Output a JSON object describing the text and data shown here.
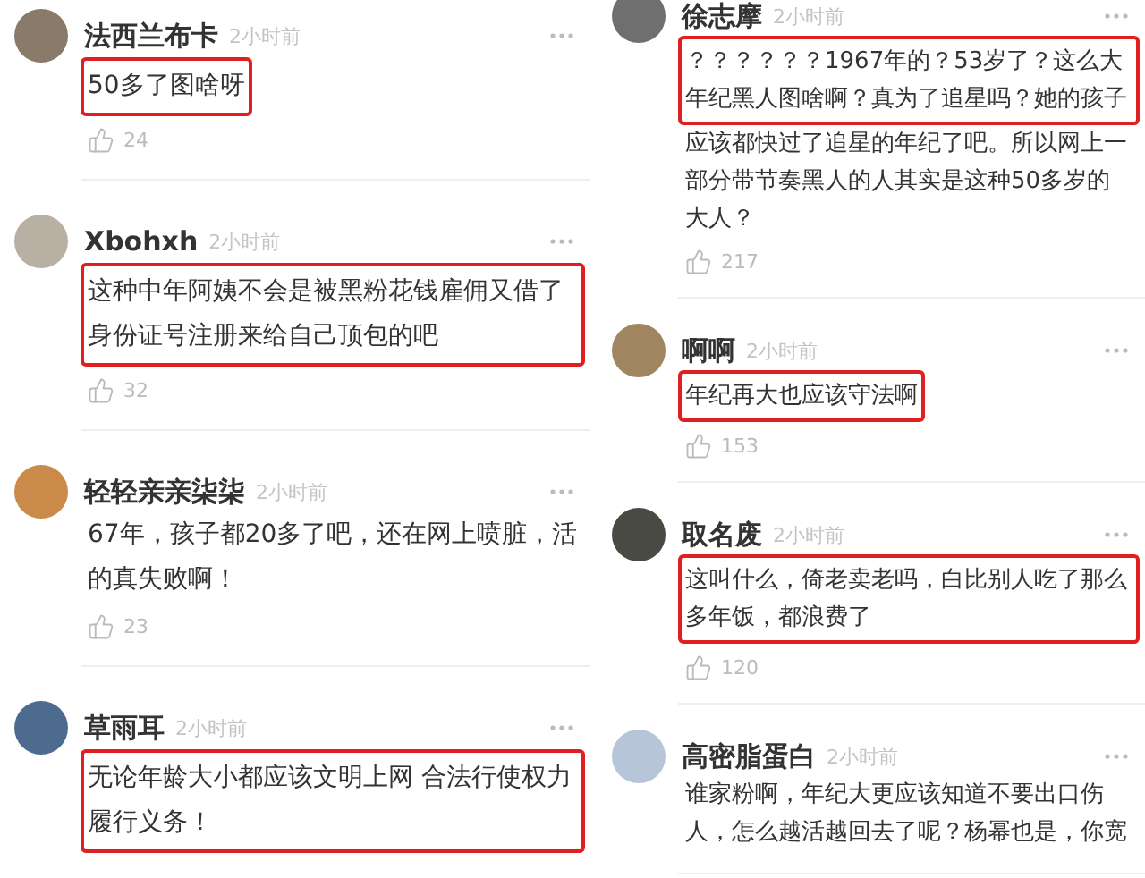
{
  "columns": [
    {
      "comments": [
        {
          "user": "法西兰布卡",
          "time": "2小时前",
          "parts": [
            {
              "text": "50多了图啥呀",
              "highlighted": true
            }
          ],
          "likes": "24"
        },
        {
          "user": "Xbohxh",
          "time": "2小时前",
          "parts": [
            {
              "text": "这种中年阿姨不会是被黑粉花钱雇佣又借了身份证号注册来给自己顶包的吧",
              "highlighted": true
            }
          ],
          "likes": "32"
        },
        {
          "user": "轻轻亲亲柒柒",
          "time": "2小时前",
          "parts": [
            {
              "text": "67年，孩子都20多了吧，还在网上喷脏，活的真失败啊！",
              "highlighted": false
            }
          ],
          "likes": "23"
        },
        {
          "user": "草雨耳",
          "time": "2小时前",
          "parts": [
            {
              "text": "无论年龄大小都应该文明上网 合法行使权力履行义务！",
              "highlighted": true
            }
          ]
        }
      ]
    },
    {
      "comments": [
        {
          "user": "徐志摩",
          "time": "2小时前",
          "parts": [
            {
              "text": "？？？？？？1967年的？53岁了？这么大年纪黑人图啥啊？真为了追星吗？她的孩子",
              "highlighted": true
            },
            {
              "text": "应该都快过了追星的年纪了吧。所以网上一部分带节奏黑人的人其实是这种50多岁的大人？",
              "highlighted": false
            }
          ],
          "likes": "217"
        },
        {
          "user": "啊啊",
          "time": "2小时前",
          "parts": [
            {
              "text": "年纪再大也应该守法啊",
              "highlighted": true
            }
          ],
          "likes": "153"
        },
        {
          "user": "取名废",
          "time": "2小时前",
          "parts": [
            {
              "text": "这叫什么，倚老卖老吗，白比别人吃了那么多年饭，都浪费了",
              "highlighted": true
            }
          ],
          "likes": "120"
        },
        {
          "user": "高密脂蛋白",
          "time": "2小时前",
          "parts": [
            {
              "text": "谁家粉啊，年纪大更应该知道不要出口伤人，怎么越活越回去了呢？杨幂也是，你宽",
              "highlighted": false
            }
          ]
        }
      ]
    }
  ]
}
